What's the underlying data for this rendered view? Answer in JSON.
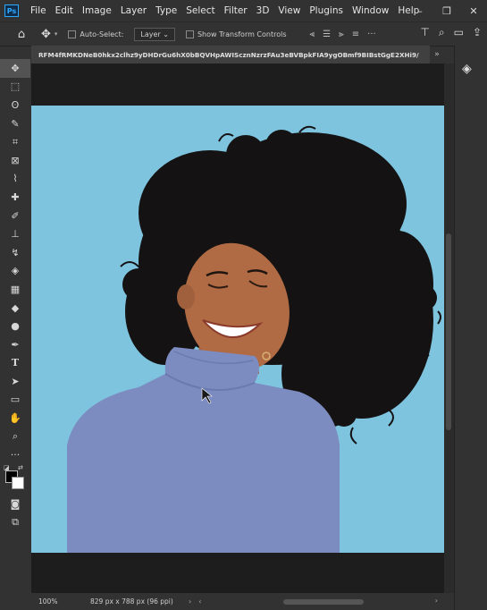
{
  "app": {
    "logo_text": "Ps"
  },
  "menu": [
    "File",
    "Edit",
    "Image",
    "Layer",
    "Type",
    "Select",
    "Filter",
    "3D",
    "View",
    "Plugins",
    "Window",
    "Help"
  ],
  "window_controls": {
    "minimize": "–",
    "restore": "❐",
    "close": "✕"
  },
  "options": {
    "home_icon": "home-icon",
    "auto_select_label": "Auto-Select:",
    "layer_dropdown": "Layer",
    "show_transform_label": "Show Transform Controls",
    "dots": "···"
  },
  "document": {
    "tab_title": "RFM4fRMKDNeB0hkx2clhz9yDHDrGu6hX0bBQVHpAWIScznNzrzFAu3eBVBpkFIA9ygOBmf9BIBstGgE2XHi9/",
    "overflow": "»"
  },
  "status": {
    "zoom": "100%",
    "doc_info": "829 px x 788 px (96 ppi)",
    "arrow_right": "›",
    "arrow_left": "‹"
  },
  "colors": {
    "accent": "#31a8ff",
    "canvas_bg": "#7fc4df",
    "sweater": "#7c8cc0",
    "hair": "#141212",
    "skin": "#b06a44"
  },
  "tools": [
    "move",
    "marquee",
    "lasso",
    "quick-select",
    "crop",
    "frame",
    "eyedropper",
    "healing",
    "brush",
    "stamp",
    "history-brush",
    "eraser",
    "gradient",
    "blur",
    "dodge",
    "pen",
    "type",
    "path-select",
    "rectangle",
    "hand",
    "zoom",
    "more"
  ]
}
